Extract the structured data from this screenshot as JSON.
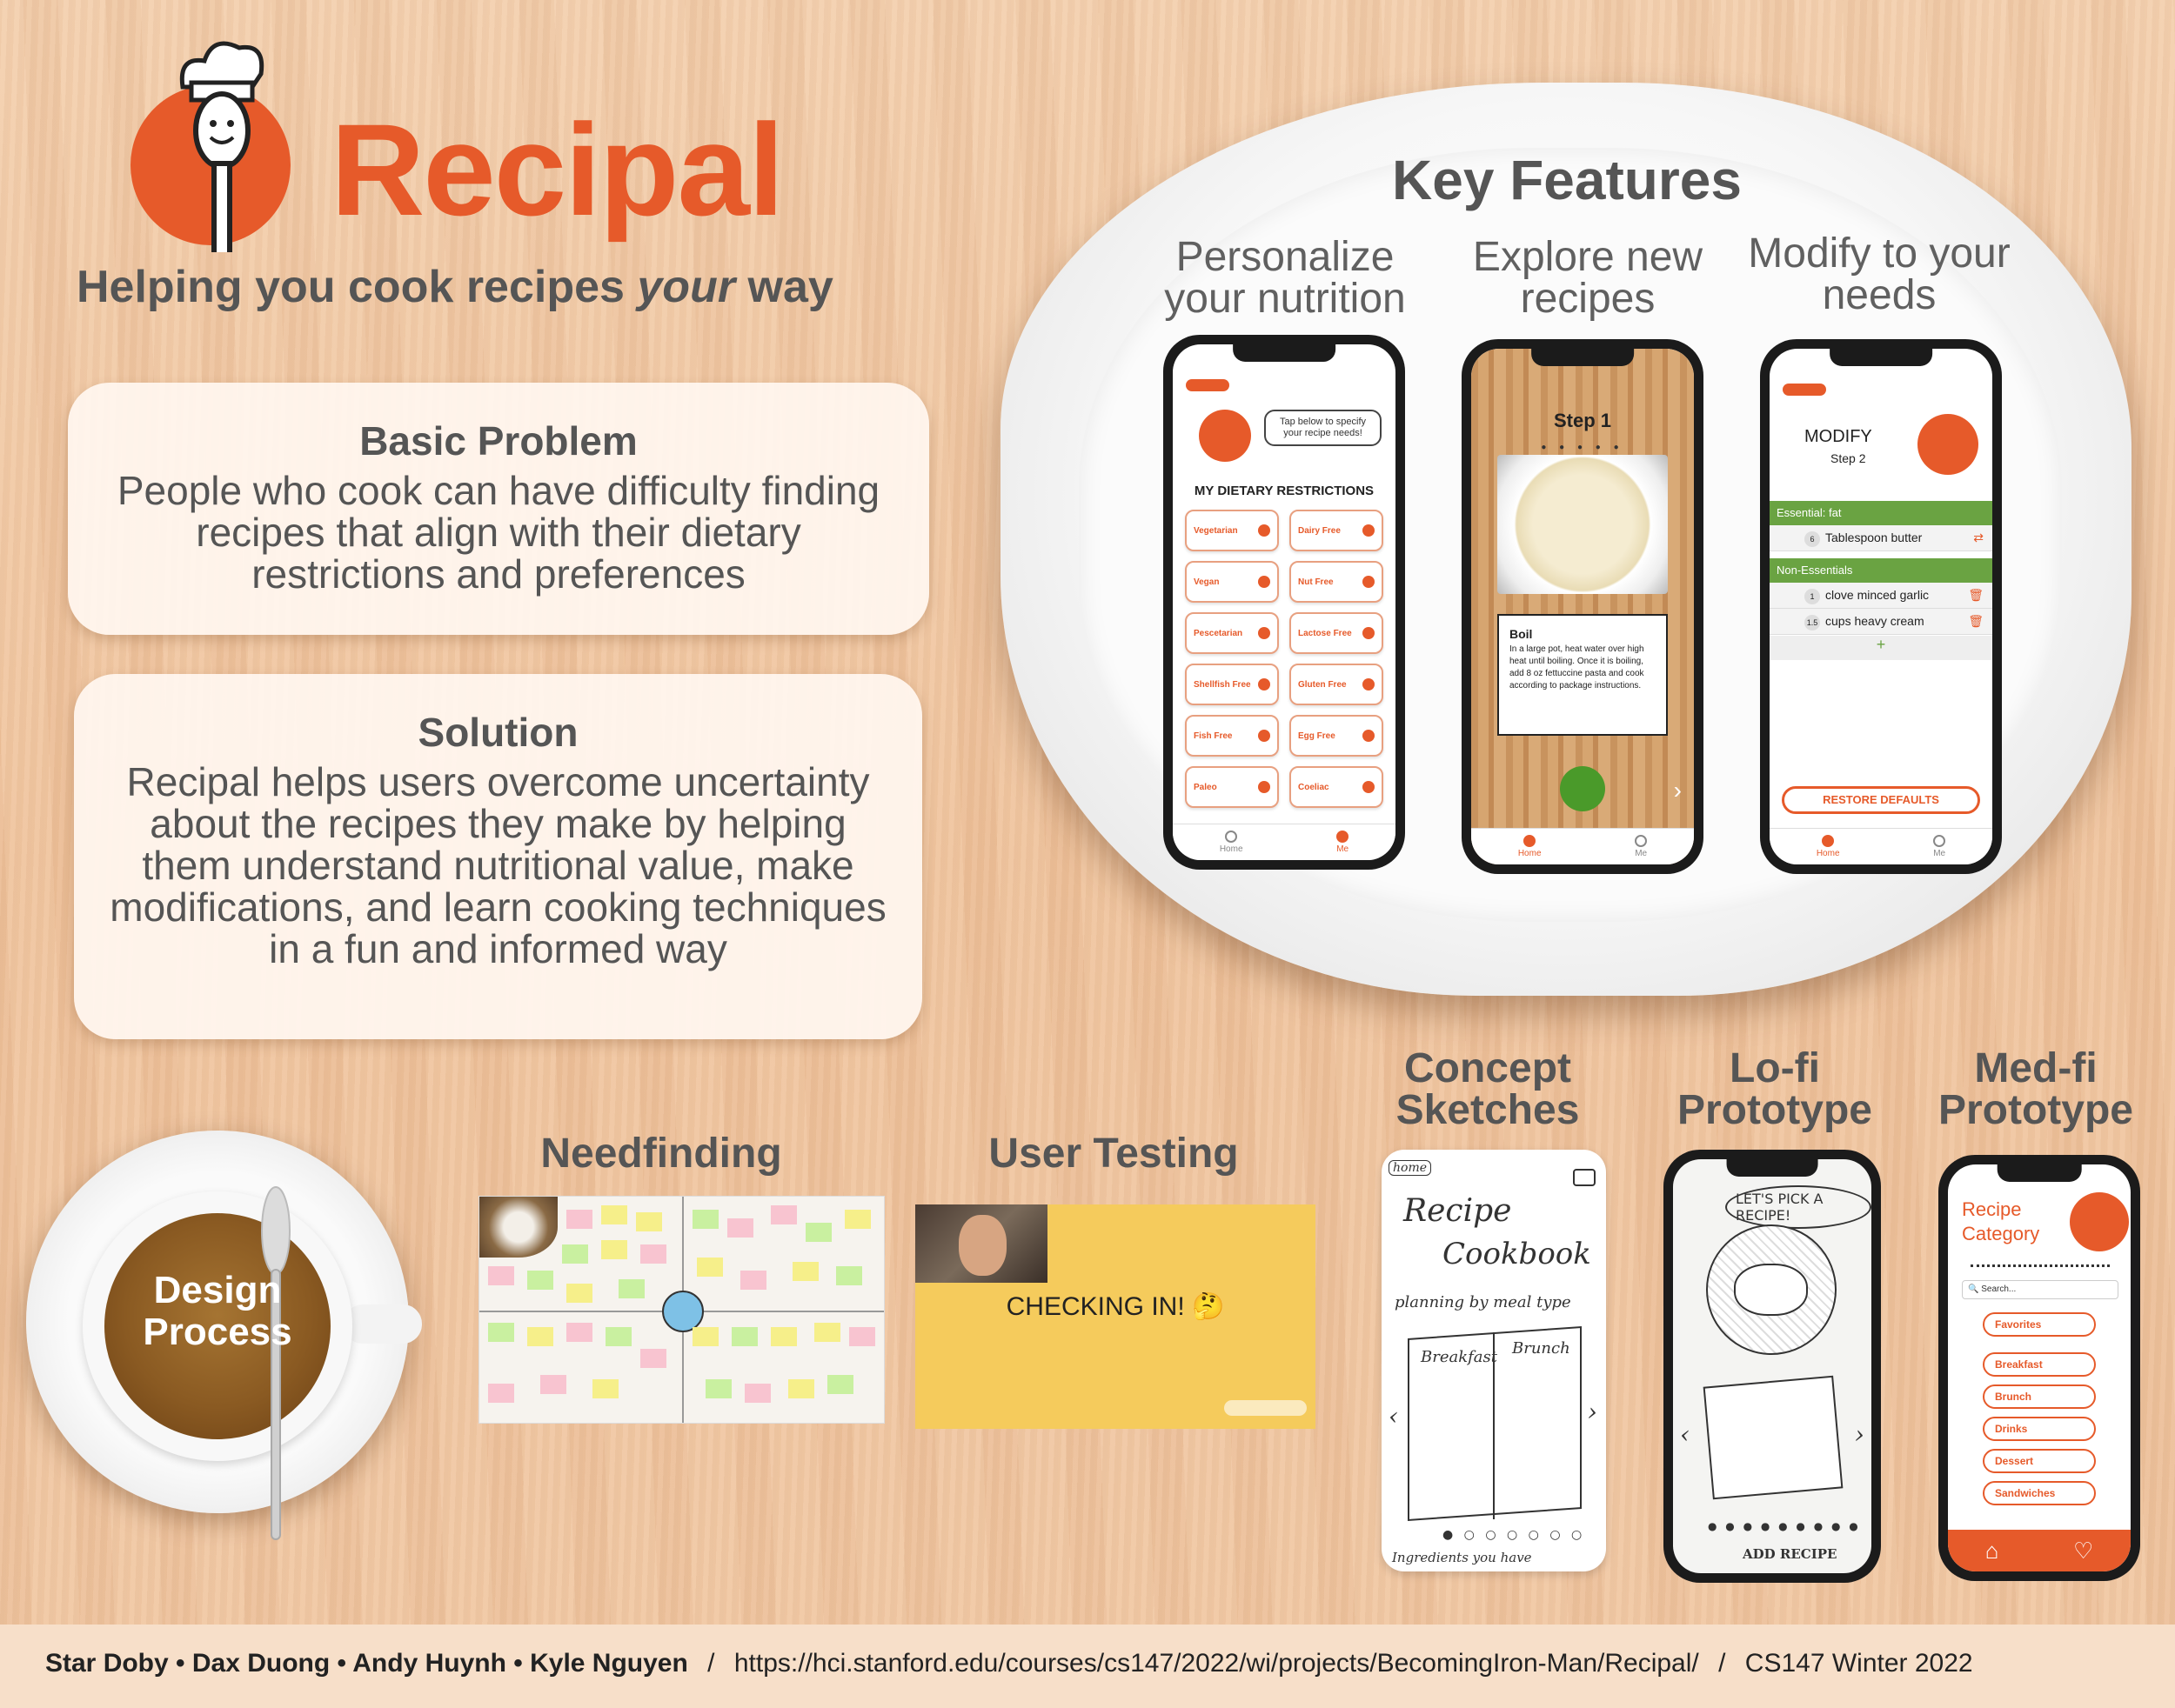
{
  "header": {
    "app_title": "Recipal",
    "tagline_pre": "Helping you cook recipes ",
    "tagline_em": "your",
    "tagline_post": " way"
  },
  "problem": {
    "title": "Basic Problem",
    "body": "People who cook can have difficulty finding recipes that align with their dietary restrictions and preferences"
  },
  "solution": {
    "title": "Solution",
    "body": "Recipal helps users overcome uncertainty about the recipes they make by helping them understand nutritional value, make modifications, and learn cooking techniques in a fun and informed way"
  },
  "key_features": {
    "title": "Key Features",
    "items": [
      {
        "label": "Personalize your nutrition"
      },
      {
        "label": "Explore new recipes"
      },
      {
        "label": "Modify to your needs"
      }
    ]
  },
  "phone1": {
    "bubble": "Tap below to specify your recipe needs!",
    "heading": "MY DIETARY RESTRICTIONS",
    "restrictions": [
      "Vegetarian",
      "Dairy Free",
      "Vegan",
      "Nut Free",
      "Pescetarian",
      "Lactose Free",
      "Shellfish Free",
      "Gluten Free",
      "Fish Free",
      "Egg Free",
      "Paleo",
      "Coeliac"
    ],
    "tabs": [
      "Home",
      "Me"
    ]
  },
  "phone2": {
    "step": "Step 1",
    "card_title": "Boil",
    "card_body": "In a large pot, heat water over high heat until boiling. Once it is boiling, add 8 oz fettuccine pasta and cook according to package instructions.",
    "tabs": [
      "Home",
      "Me"
    ]
  },
  "phone3": {
    "title": "MODIFY",
    "step": "Step 2",
    "essential_label": "Essential: fat",
    "essential_item": {
      "qty": "6",
      "name": "Tablespoon butter"
    },
    "nonessential_label": "Non-Essentials",
    "nonessential_items": [
      {
        "qty": "1",
        "name": "clove minced garlic"
      },
      {
        "qty": "1.5",
        "name": "cups heavy cream"
      }
    ],
    "add": "+",
    "restore": "RESTORE DEFAULTS",
    "tabs": [
      "Home",
      "Me"
    ]
  },
  "design": {
    "cup_label": "Design Process",
    "needfinding": "Needfinding",
    "user_testing": "User Testing",
    "user_testing_caption": "CHECKING IN! 🤔",
    "concept_sketches": "Concept Sketches",
    "lofi": "Lo-fi Prototype",
    "medfi": "Med-fi Prototype"
  },
  "sketch": {
    "home": "home",
    "line1": "Recipe",
    "line2": "Cookbook",
    "line3": "planning by meal type",
    "left_page": "Breakfast",
    "right_page": "Brunch",
    "bottom": "Ingredients you have"
  },
  "lofi": {
    "bubble": "LET'S PICK A RECIPE!",
    "add": "ADD RECIPE"
  },
  "medfi": {
    "title": "Recipe Category",
    "search": "Search...",
    "categories": [
      "Favorites",
      "Breakfast",
      "Brunch",
      "Drinks",
      "Dessert",
      "Sandwiches"
    ]
  },
  "footer": {
    "authors": "Star Doby • Dax Duong • Andy Huynh • Kyle Nguyen",
    "sep": "/",
    "url": "https://hci.stanford.edu/courses/cs147/2022/wi/projects/BecomingIron-Man/Recipal/",
    "course": "CS147 Winter 2022"
  },
  "colors": {
    "brand_orange": "#e65a2a",
    "green": "#6aa342",
    "card_bg": "#fff6ee"
  }
}
